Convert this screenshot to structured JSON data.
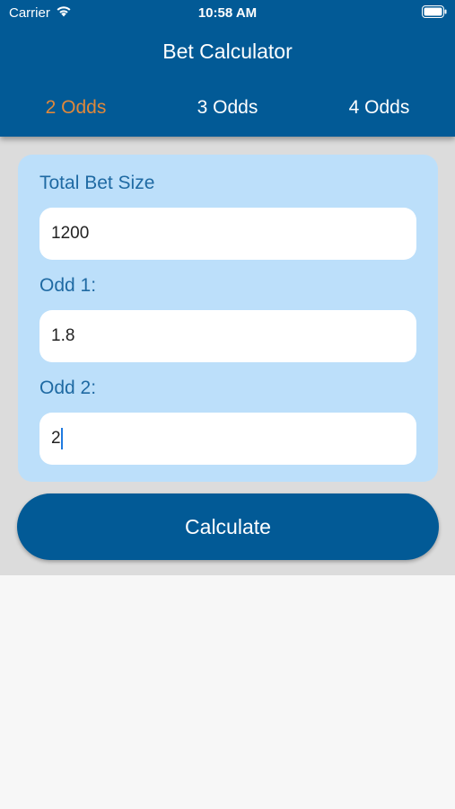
{
  "status_bar": {
    "carrier": "Carrier",
    "time": "10:58 AM"
  },
  "header": {
    "title": "Bet Calculator",
    "tabs": [
      {
        "label": "2 Odds",
        "active": true
      },
      {
        "label": "3 Odds",
        "active": false
      },
      {
        "label": "4 Odds",
        "active": false
      }
    ]
  },
  "form": {
    "total_bet_label": "Total Bet Size",
    "total_bet_value": "1200",
    "odd1_label": "Odd 1:",
    "odd1_value": "1.8",
    "odd2_label": "Odd 2:",
    "odd2_value": "2"
  },
  "calculate_label": "Calculate",
  "colors": {
    "primary": "#025a96",
    "active_tab": "#e0883a",
    "card": "#bcdffa",
    "label": "#1f6aa3"
  }
}
